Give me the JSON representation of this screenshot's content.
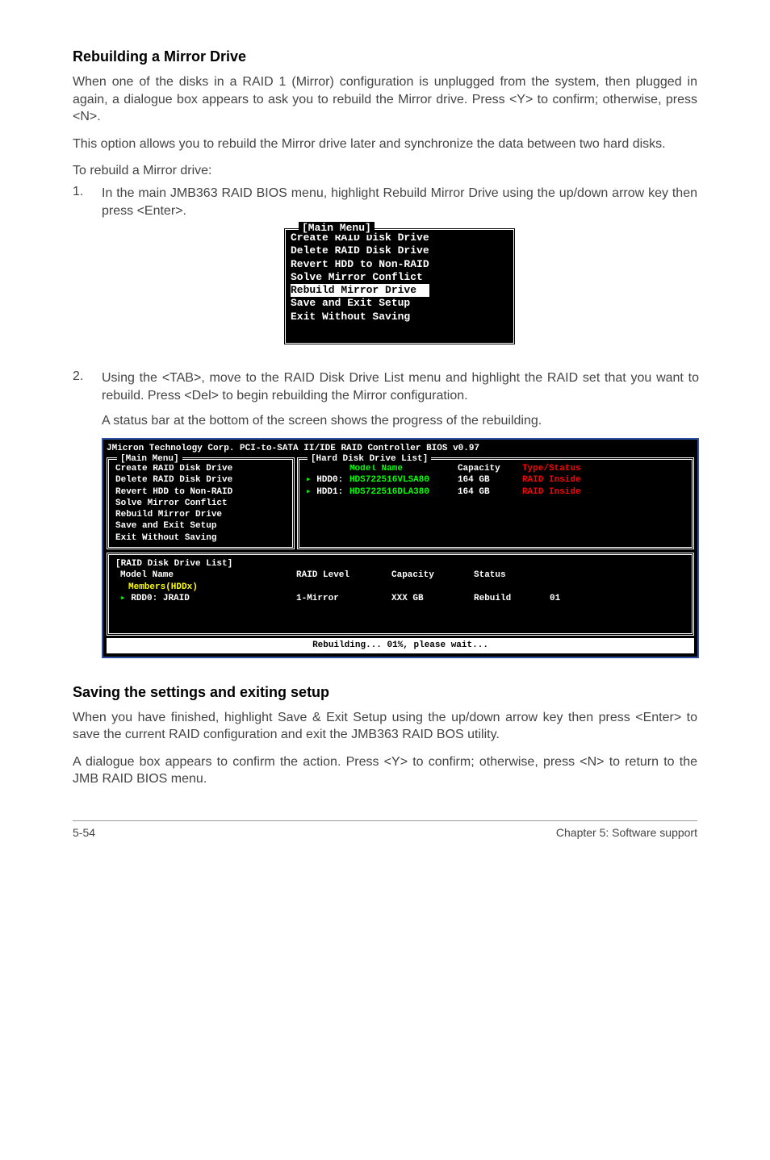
{
  "headings": {
    "h1": "Rebuilding a Mirror Drive",
    "h2": "Saving the settings and exiting setup"
  },
  "paragraphs": {
    "p1": "When one of the disks in a RAID 1 (Mirror) configuration is unplugged from the system, then plugged in again, a dialogue box appears to ask you to rebuild the Mirror drive. Press <Y> to confirm; otherwise, press <N>.",
    "p2": "This option allows you to rebuild the Mirror drive later and synchronize the data between two hard disks.",
    "p3": "To rebuild a Mirror drive:",
    "step1": "In the main JMB363 RAID BIOS menu, highlight Rebuild Mirror Drive using the up/down arrow key then press <Enter>.",
    "step2a": "Using the <TAB>, move to the RAID Disk Drive List menu and highlight the RAID set that you want to rebuild. Press <Del> to begin rebuilding the Mirror configuration.",
    "step2b": "A status bar at the bottom of the screen shows the progress of the rebuilding.",
    "p4": "When you have finished, highlight Save & Exit Setup using the up/down arrow key then press <Enter> to save the current RAID configuration and exit the JMB363 RAID BOS utility.",
    "p5": "A dialogue box appears to confirm the action. Press <Y> to confirm; otherwise, press <N> to return to the JMB RAID BIOS menu."
  },
  "bios_small": {
    "title": "[Main Menu]",
    "items": [
      "Create RAID Disk Drive",
      "Delete RAID Disk Drive",
      "Revert HDD to Non-RAID",
      "Solve Mirror Conflict",
      "Rebuild Mirror Drive",
      "Save and Exit Setup",
      "Exit Without Saving"
    ],
    "highlight_index": 4
  },
  "bios_large": {
    "top_title": "JMicron Technology Corp. PCI-to-SATA II/IDE RAID Controller BIOS v0.97",
    "main_menu_label": "[Main Menu]",
    "main_menu_items": [
      "Create RAID Disk Drive",
      "Delete RAID Disk Drive",
      "Revert HDD to Non-RAID",
      "Solve Mirror Conflict",
      "Rebuild Mirror Drive",
      "Save and Exit Setup",
      "Exit Without Saving"
    ],
    "hdd_panel_label": "[Hard Disk Drive List]",
    "hdd_headers": {
      "c1": "",
      "c2": "Model Name",
      "c3": "Capacity",
      "c4": "Type/Status"
    },
    "hdd_rows": [
      {
        "c1": "HDD0:",
        "c2": "HDS722516VLSA80",
        "c3": "164 GB",
        "c4": "RAID Inside"
      },
      {
        "c1": "HDD1:",
        "c2": "HDS722516DLA380",
        "c3": "164 GB",
        "c4": "RAID Inside"
      }
    ],
    "raid_panel_label": "[RAID Disk Drive List]",
    "raid_headers": {
      "d1": "Model Name",
      "d2": "RAID Level",
      "d3": "Capacity",
      "d4": "Status"
    },
    "raid_members": "Members(HDDx)",
    "raid_row": {
      "d1": "RDD0:  JRAID",
      "d2": "1-Mirror",
      "d3": "XXX GB",
      "d4": "Rebuild",
      "d5": "01"
    },
    "status": "Rebuilding... 01%, please wait..."
  },
  "footer": {
    "left": "5-54",
    "right": "Chapter 5: Software support"
  },
  "list_numbers": {
    "n1": "1.",
    "n2": "2."
  }
}
